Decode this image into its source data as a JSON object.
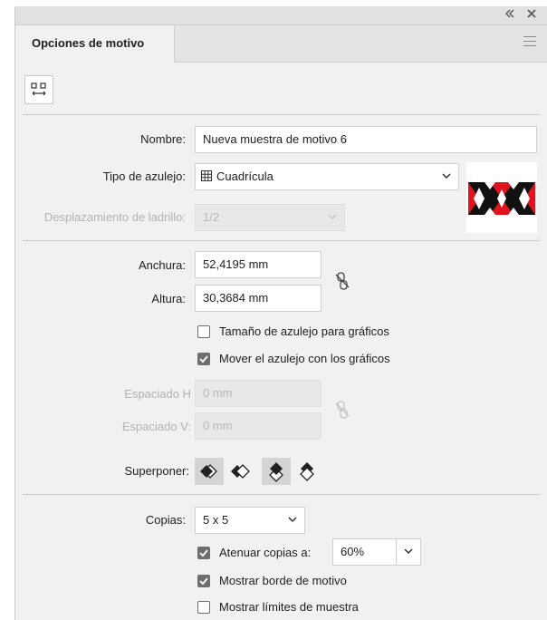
{
  "panel": {
    "tab_label": "Opciones de motivo",
    "collapse_icon": "double-chevron-left-icon",
    "close_icon": "close-icon",
    "menu_icon": "hamburger-menu-icon"
  },
  "toolbar": {
    "edit_tile_icon": "pattern-tile-tool-icon"
  },
  "form": {
    "name_label": "Nombre:",
    "name_value": "Nueva muestra de motivo 6",
    "tile_type_label": "Tipo de azulejo:",
    "tile_type_value": "Cuadrícula",
    "tile_type_icon": "grid-icon",
    "brick_offset_label": "Desplazamiento de ladrillo:",
    "brick_offset_value": "1/2",
    "width_label": "Anchura:",
    "width_value": "52,4195 mm",
    "height_label": "Altura:",
    "height_value": "30,3684 mm",
    "link_icon": "unlink-chain-icon",
    "size_to_art_label": "Tamaño de azulejo para gráficos",
    "size_to_art_checked": false,
    "move_with_art_label": "Mover el azulejo con los gráficos",
    "move_with_art_checked": true,
    "h_spacing_label": "Espaciado H",
    "h_spacing_value": "0 mm",
    "v_spacing_label": "Espaciado V:",
    "v_spacing_value": "0 mm",
    "overlap_label": "Superponer:",
    "copies_label": "Copias:",
    "copies_value": "5 x 5",
    "dim_copies_label": "Atenuar copias a:",
    "dim_copies_checked": true,
    "dim_copies_value": "60%",
    "show_tile_edge_label": "Mostrar borde de motivo",
    "show_tile_edge_checked": true,
    "show_swatch_bounds_label": "Mostrar límites de muestra",
    "show_swatch_bounds_checked": false
  },
  "colors": {
    "panel_bg": "#f1f1f1",
    "accent_red": "#e0141e",
    "checkbox_checked": "#6d6d6d",
    "disabled_text": "#b2b2b2"
  }
}
